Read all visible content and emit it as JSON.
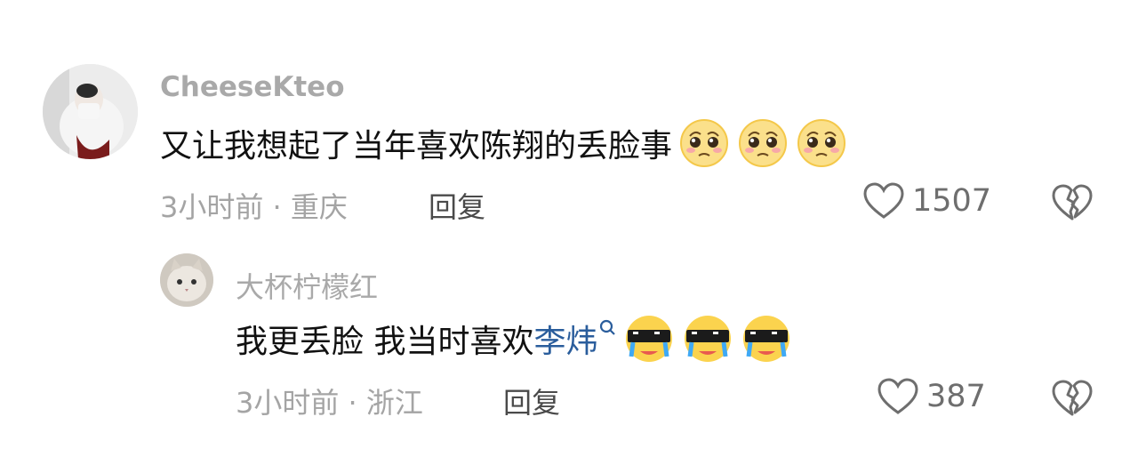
{
  "comments": [
    {
      "username": "CheeseKteo",
      "text": "又让我想起了当年喜欢陈翔的丢脸事",
      "emojis": [
        "pleading-face-emoji",
        "pleading-face-emoji",
        "pleading-face-emoji"
      ],
      "time": "3小时前 · 重庆",
      "reply_label": "回复",
      "like_count": "1507"
    },
    {
      "username": "大杯柠檬红",
      "text_prefix": "我更丢脸 我当时喜欢",
      "link_text": "李炜",
      "emojis": [
        "crying-sunglasses-emoji",
        "crying-sunglasses-emoji",
        "crying-sunglasses-emoji"
      ],
      "time": "3小时前 · 浙江",
      "reply_label": "回复",
      "like_count": "387"
    }
  ],
  "colors": {
    "link": "#2a5d9c",
    "username": "#a9a9a9",
    "meta": "#a4a4a4"
  }
}
